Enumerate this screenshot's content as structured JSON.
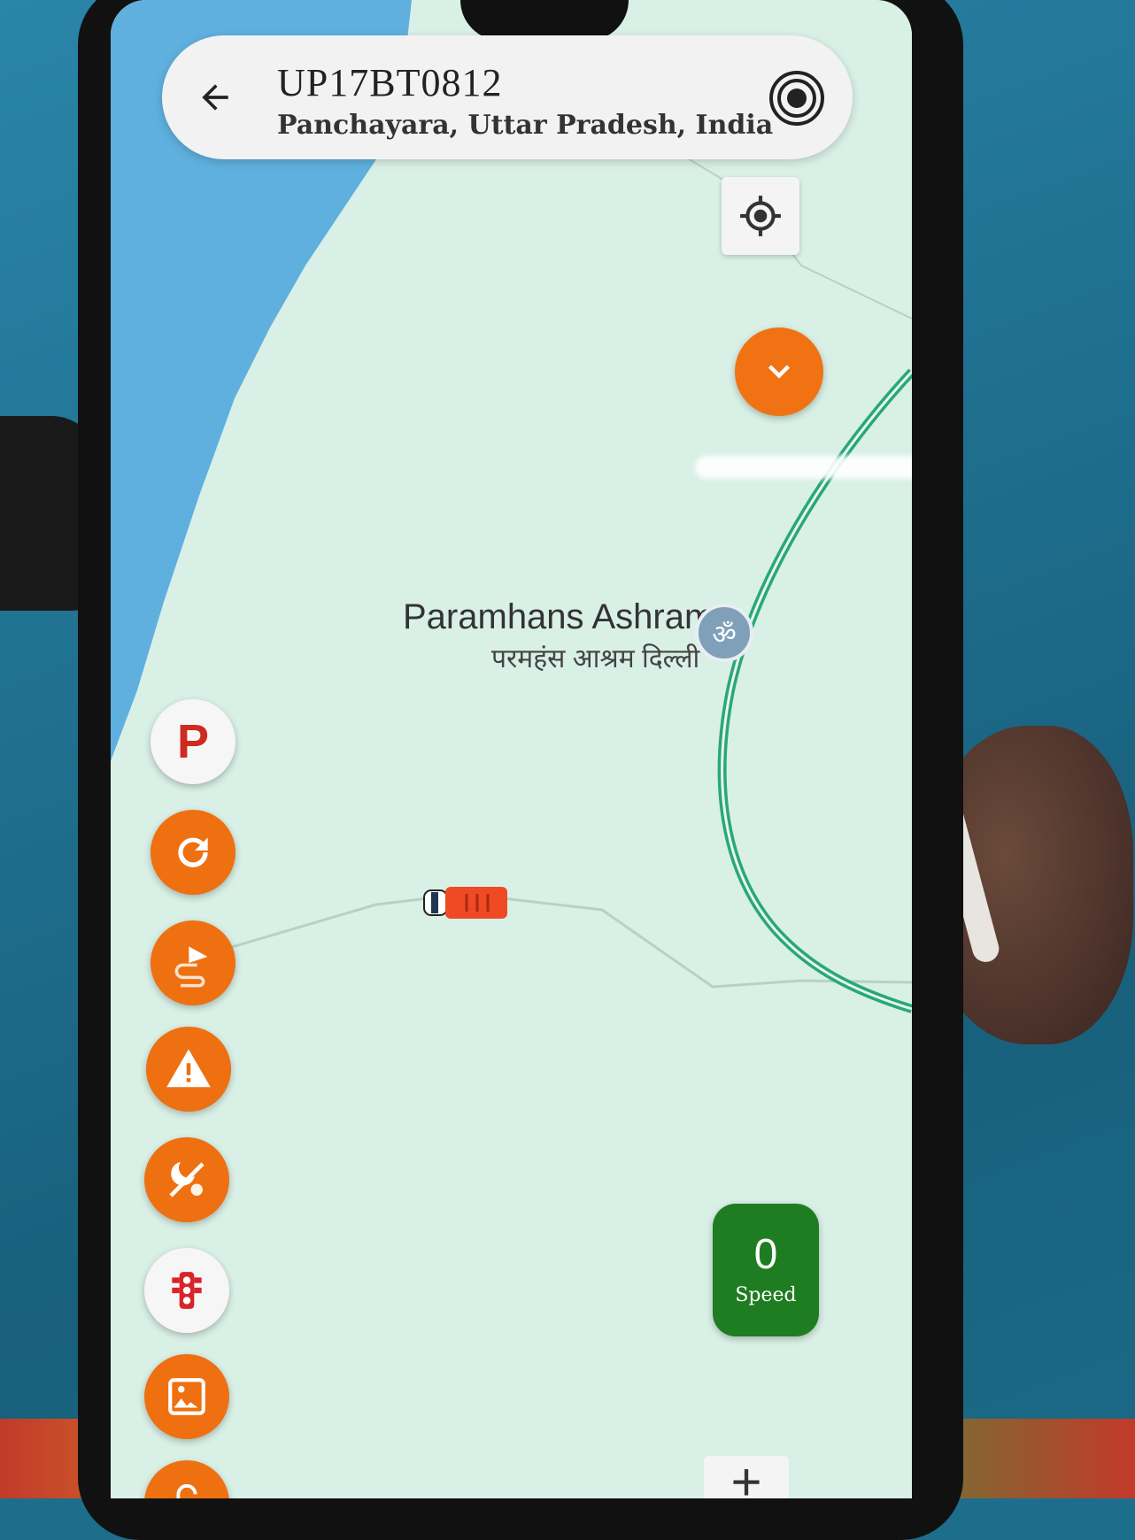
{
  "header": {
    "vehicle_number": "UP17BT0812",
    "location": "Panchayara, Uttar Pradesh, India",
    "back_icon": "arrow-left-icon",
    "target_icon": "target-icon"
  },
  "map": {
    "poi": {
      "name": "Paramhans Ashram",
      "name_hindi": "परमहंस आश्रम दिल्ली",
      "icon": "om-icon",
      "icon_glyph": "ॐ"
    },
    "colors": {
      "land": "#d9f0e6",
      "water": "#5fb0de",
      "route": "#2aa77a",
      "accent": "#ef7011",
      "speed_bg": "#1e7d21"
    }
  },
  "side_buttons": [
    {
      "name": "parking-button",
      "icon": "parking-icon",
      "label": "P"
    },
    {
      "name": "refresh-button",
      "icon": "refresh-icon"
    },
    {
      "name": "route-playback-button",
      "icon": "route-icon"
    },
    {
      "name": "alert-button",
      "icon": "warning-icon"
    },
    {
      "name": "day-night-button",
      "icon": "day-night-icon"
    },
    {
      "name": "traffic-button",
      "icon": "traffic-light-icon"
    },
    {
      "name": "image-button",
      "icon": "image-icon"
    }
  ],
  "speed": {
    "value": "0",
    "label": "Speed"
  },
  "zoom": {
    "zoom_in": "+"
  }
}
